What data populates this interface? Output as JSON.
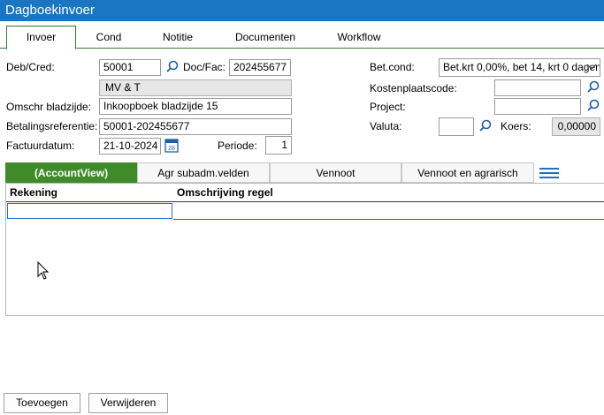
{
  "window": {
    "title": "Dagboekinvoer"
  },
  "tabs": [
    {
      "label": "Invoer",
      "active": true
    },
    {
      "label": "Cond",
      "active": false
    },
    {
      "label": "Notitie",
      "active": false
    },
    {
      "label": "Documenten",
      "active": false
    },
    {
      "label": "Workflow",
      "active": false
    }
  ],
  "form": {
    "deb_cred_label": "Deb/Cred:",
    "deb_cred_value": "50001",
    "doc_fac_label": "Doc/Fac:",
    "doc_fac_value": "202455677",
    "name_value": "MV & T",
    "omschr_label": "Omschr bladzijde:",
    "omschr_value": "Inkoopboek bladzijde 15",
    "betref_label": "Betalingsreferentie:",
    "betref_value": "50001-202455677",
    "factuurdatum_label": "Factuurdatum:",
    "factuurdatum_value": "21-10-2024",
    "periode_label": "Periode:",
    "periode_value": "1",
    "betcond_label": "Bet.cond:",
    "betcond_value": "Bet.krt 0,00%, bet 14, krt 0 dagen",
    "kostenplaats_label": "Kostenplaatscode:",
    "kostenplaats_value": "",
    "project_label": "Project:",
    "project_value": "",
    "valuta_label": "Valuta:",
    "valuta_value": "",
    "koers_label": "Koers:",
    "koers_value": "0,00000"
  },
  "subtabs": [
    {
      "label": "(AccountView)",
      "active": true
    },
    {
      "label": "Agr subadm.velden",
      "active": false
    },
    {
      "label": "Vennoot",
      "active": false
    },
    {
      "label": "Vennoot en agrarisch",
      "active": false
    }
  ],
  "grid": {
    "columns": [
      "Rekening",
      "Omschrijving regel"
    ]
  },
  "buttons": {
    "add": "Toevoegen",
    "delete": "Verwijderen"
  },
  "colors": {
    "titlebar": "#1a75c2",
    "accent_green": "#3f8a29",
    "selection_blue": "#2d6fc0"
  }
}
